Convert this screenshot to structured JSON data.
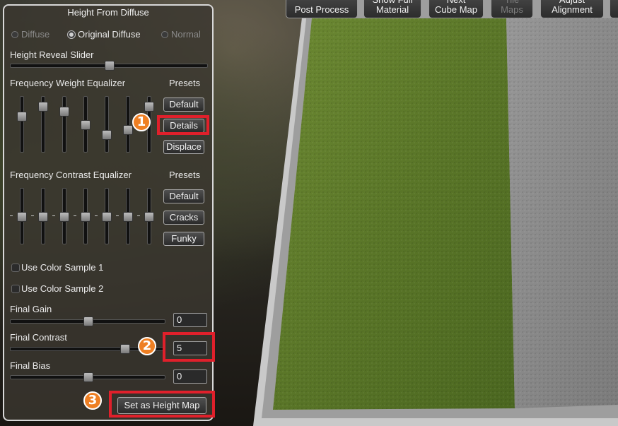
{
  "toolbar": {
    "buttons": [
      {
        "label": "Post Process",
        "enabled": true
      },
      {
        "label": "Show Full\nMaterial",
        "enabled": true
      },
      {
        "label": "Next\nCube Map",
        "enabled": true
      },
      {
        "label": "Tile\nMaps",
        "enabled": false
      },
      {
        "label": "Adjust\nAlignment",
        "enabled": true
      }
    ]
  },
  "panel": {
    "title": "Height From Diffuse",
    "source_options": [
      {
        "label": "Diffuse",
        "selected": false,
        "enabled": false
      },
      {
        "label": "Original Diffuse",
        "selected": true,
        "enabled": true
      },
      {
        "label": "Normal",
        "selected": false,
        "enabled": false
      }
    ],
    "height_reveal_label": "Height Reveal Slider",
    "height_reveal_value": 0.5,
    "freq_weight": {
      "label": "Frequency Weight Equalizer",
      "presets_label": "Presets",
      "slider_values": [
        0.65,
        0.83,
        0.75,
        0.5,
        0.32,
        0.41,
        0.83
      ],
      "presets": [
        "Default",
        "Details",
        "Displace"
      ]
    },
    "freq_contrast": {
      "label": "Frequency Contrast Equalizer",
      "presets_label": "Presets",
      "slider_values": [
        0.5,
        0.5,
        0.5,
        0.5,
        0.5,
        0.5,
        0.5
      ],
      "presets": [
        "Default",
        "Cracks",
        "Funky"
      ]
    },
    "color_samples": [
      {
        "label": "Use Color Sample 1",
        "checked": false
      },
      {
        "label": "Use Color Sample 2",
        "checked": false
      }
    ],
    "final_gain": {
      "label": "Final Gain",
      "value": "0",
      "slider": 0.5
    },
    "final_contrast": {
      "label": "Final Contrast",
      "value": "5",
      "slider": 0.74
    },
    "final_bias": {
      "label": "Final Bias",
      "value": "0",
      "slider": 0.5
    },
    "apply_button": "Set as Height Map"
  },
  "annotations": {
    "markers": [
      "1",
      "2",
      "3"
    ],
    "color": "#e0202b",
    "marker_color": "#ee7f23"
  },
  "scene": {
    "grass_color": "#5c7a2a",
    "height_map_color": "#8a8a8a",
    "frame_color": "#c9c9c9"
  }
}
